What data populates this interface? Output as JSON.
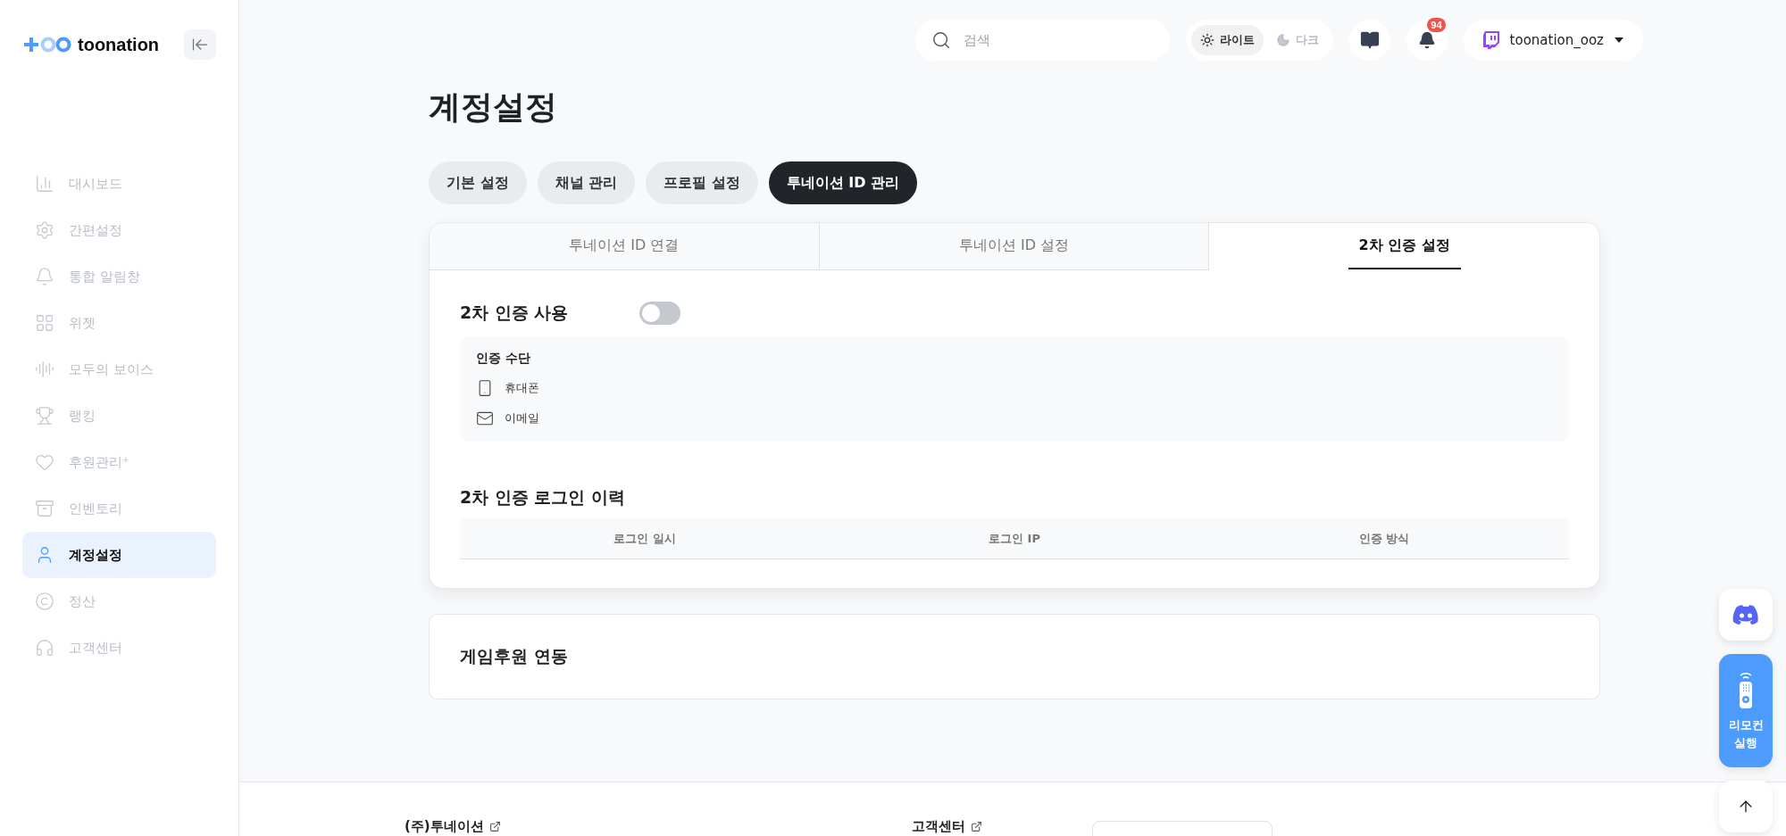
{
  "logo": {
    "text": "toonation"
  },
  "sidebar": {
    "items": [
      {
        "label": "대시보드",
        "selected": false
      },
      {
        "label": "간편설정",
        "selected": false
      },
      {
        "label": "통합 알림창",
        "selected": false
      },
      {
        "label": "위젯",
        "selected": false
      },
      {
        "label": "모두의 보이스",
        "selected": false
      },
      {
        "label": "랭킹",
        "selected": false
      },
      {
        "label": "후원관리⁺",
        "selected": false
      },
      {
        "label": "인벤토리",
        "selected": false
      },
      {
        "label": "계정설정",
        "selected": true
      },
      {
        "label": "정산",
        "selected": false
      },
      {
        "label": "고객센터",
        "selected": false
      }
    ]
  },
  "topbar": {
    "search": {
      "placeholder": "검색"
    },
    "theme": [
      {
        "label": "라이트",
        "selected": true
      },
      {
        "label": "다크",
        "selected": false
      }
    ],
    "notifications": {
      "badge": "94"
    },
    "user": {
      "name": "toonation_ooz"
    }
  },
  "page": {
    "title": "계정설정"
  },
  "tabs": [
    {
      "label": "기본 설정",
      "selected": false
    },
    {
      "label": "채널 관리",
      "selected": false
    },
    {
      "label": "프로필 설정",
      "selected": false
    },
    {
      "label": "투네이션 ID 관리",
      "selected": true
    }
  ],
  "subtabs": [
    {
      "label": "투네이션 ID 연결",
      "selected": false
    },
    {
      "label": "투네이션 ID 설정",
      "selected": false
    },
    {
      "label": "2차 인증 설정",
      "selected": true
    }
  ],
  "two_factor": {
    "label": "2차 인증 사용",
    "on": false,
    "methods_title": "인증 수단",
    "methods": [
      {
        "label": "휴대폰"
      },
      {
        "label": "이메일"
      }
    ]
  },
  "login_history": {
    "title": "2차 인증 로그인 이력",
    "columns": [
      "로그인 일시",
      "로그인 IP",
      "인증 방식"
    ]
  },
  "game_card": {
    "title": "게임후원 연동"
  },
  "floating": {
    "remote": {
      "label": "리모컨 실행"
    }
  },
  "footer": {
    "links": [
      "(주)투네이션",
      "고객센터"
    ]
  }
}
